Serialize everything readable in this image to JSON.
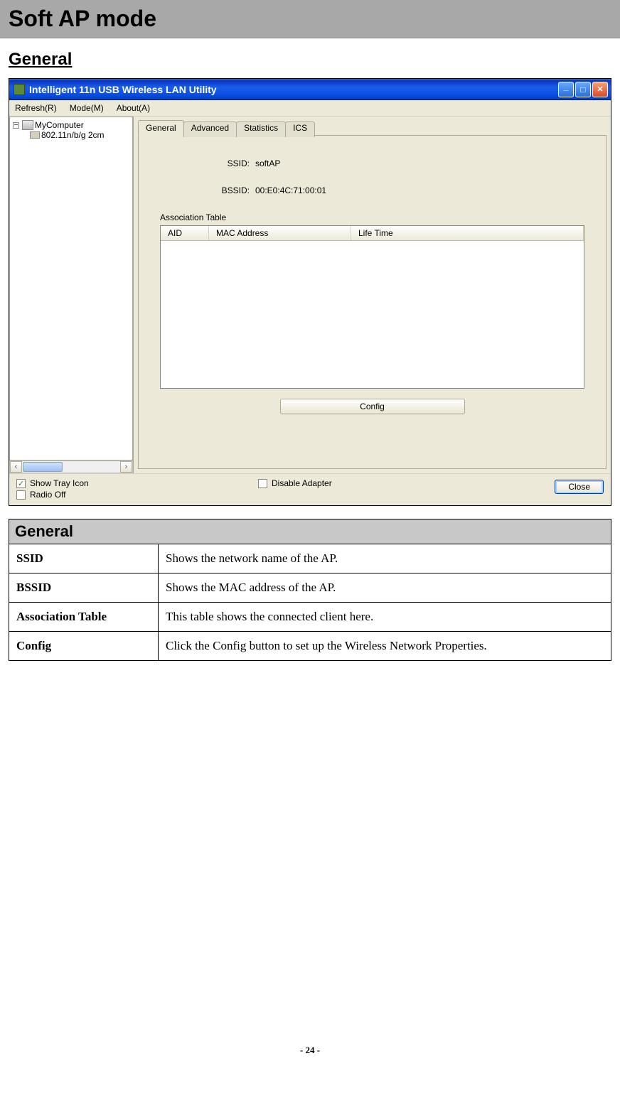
{
  "page": {
    "title": "Soft AP mode",
    "section_heading": "General",
    "page_number": "- 24 -"
  },
  "app_window": {
    "title": "Intelligent 11n USB Wireless LAN Utility",
    "menu": {
      "refresh": "Refresh(R)",
      "mode": "Mode(M)",
      "about": "About(A)"
    },
    "tree": {
      "root": "MyComputer",
      "child": "802.11n/b/g 2cm"
    },
    "tabs": {
      "general": "General",
      "advanced": "Advanced",
      "statistics": "Statistics",
      "ics": "ICS"
    },
    "general_tab": {
      "ssid_label": "SSID:",
      "ssid_value": "softAP",
      "bssid_label": "BSSID:",
      "bssid_value": "00:E0:4C:71:00:01",
      "assoc_label": "Association Table",
      "columns": {
        "aid": "AID",
        "mac": "MAC Address",
        "life": "Life Time"
      },
      "config_button": "Config"
    },
    "footer": {
      "show_tray": "Show Tray Icon",
      "radio_off": "Radio Off",
      "disable_adapter": "Disable Adapter",
      "close": "Close"
    }
  },
  "desc_table": {
    "section": "General",
    "rows": [
      {
        "key": "SSID",
        "val": "Shows the network name of the AP."
      },
      {
        "key": "BSSID",
        "val": "Shows the MAC address of the AP."
      },
      {
        "key": "Association Table",
        "val": "This table shows the connected client here."
      },
      {
        "key": "Config",
        "val": "Click the Config button to set up the Wireless Network Properties."
      }
    ]
  }
}
